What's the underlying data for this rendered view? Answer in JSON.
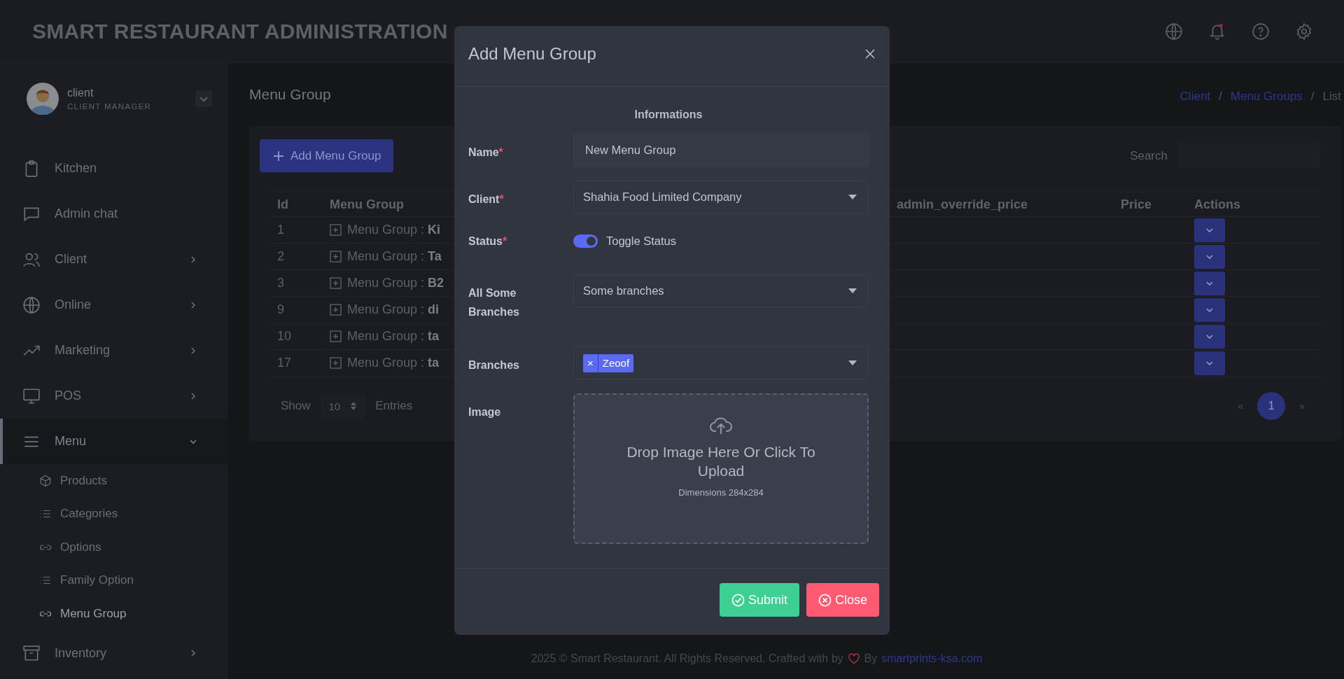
{
  "header": {
    "title": "SMART RESTAURANT ADMINISTRATION"
  },
  "user": {
    "name": "client",
    "role": "CLIENT MANAGER"
  },
  "sidebar": {
    "items": [
      {
        "label": "Kitchen",
        "kind": "link",
        "selected": false
      },
      {
        "label": "Admin chat",
        "kind": "link",
        "selected": false
      },
      {
        "label": "Client",
        "kind": "group",
        "expanded": false,
        "selected": false
      },
      {
        "label": "Online",
        "kind": "group",
        "expanded": false,
        "selected": false
      },
      {
        "label": "Marketing",
        "kind": "group",
        "expanded": false,
        "selected": false
      },
      {
        "label": "POS",
        "kind": "group",
        "expanded": false,
        "selected": false
      },
      {
        "label": "Menu",
        "kind": "group",
        "expanded": true,
        "selected": true,
        "children": [
          {
            "label": "Products",
            "selected": false
          },
          {
            "label": "Categories",
            "selected": false
          },
          {
            "label": "Options",
            "selected": false
          },
          {
            "label": "Family Option",
            "selected": false
          },
          {
            "label": "Menu Group",
            "selected": true
          }
        ]
      },
      {
        "label": "Inventory",
        "kind": "group",
        "expanded": false,
        "selected": false
      }
    ]
  },
  "page": {
    "title": "Menu Group",
    "breadcrumb": [
      {
        "label": "Client",
        "kind": "link"
      },
      {
        "label": "Menu Groups",
        "kind": "link"
      },
      {
        "label": "List",
        "kind": "current"
      }
    ],
    "separator": "/"
  },
  "toolbar": {
    "add_button": "Add Menu Group",
    "search_label": "Search"
  },
  "table": {
    "columns": [
      "Id",
      "Menu Group",
      "admin_override_price",
      "Price",
      "Actions"
    ],
    "rows": [
      {
        "id": "1",
        "menu_group": "Menu Group : **Ki**"
      },
      {
        "id": "2",
        "menu_group": "Menu Group : **Ta**"
      },
      {
        "id": "3",
        "menu_group": "Menu Group : **B2**"
      },
      {
        "id": "9",
        "menu_group": "Menu Group : **di**"
      },
      {
        "id": "10",
        "menu_group": "Menu Group : **ta**"
      },
      {
        "id": "17",
        "menu_group": "Menu Group : **ta**"
      }
    ]
  },
  "pagination": {
    "show_label": "Show",
    "page_size": "10",
    "entries_label": "Entries",
    "prev": "«",
    "next": "»",
    "pages": [
      {
        "label": "1",
        "selected": true
      }
    ]
  },
  "footer": {
    "text": "2025 © Smart Restaurant. All Rights Reserved. Crafted with by",
    "by": "By",
    "link": "smartprints-ksa.com"
  },
  "modal": {
    "title": "Add Menu Group",
    "section": "Informations",
    "required_mark": "*",
    "fields": [
      {
        "kind": "text",
        "label": "Name",
        "required": true,
        "value": "New Menu Group"
      },
      {
        "kind": "select",
        "label": "Client",
        "required": true,
        "value": "Shahia Food Limited Company"
      },
      {
        "kind": "toggle",
        "label": "Status",
        "required": true,
        "on": true,
        "text": "Toggle Status"
      },
      {
        "kind": "select",
        "label": "All Some Branches",
        "required": false,
        "value": "Some branches"
      },
      {
        "kind": "tags",
        "label": "Branches",
        "required": false,
        "tags": [
          {
            "remove": "×",
            "label": "Zeoof"
          }
        ]
      },
      {
        "kind": "upload",
        "label": "Image",
        "required": false,
        "prompt": "Drop Image Here Or Click To Upload",
        "hint": "Dimensions 284x284"
      }
    ],
    "buttons": [
      {
        "kind": "submit",
        "label": "Submit"
      },
      {
        "kind": "close",
        "label": "Close"
      }
    ]
  }
}
